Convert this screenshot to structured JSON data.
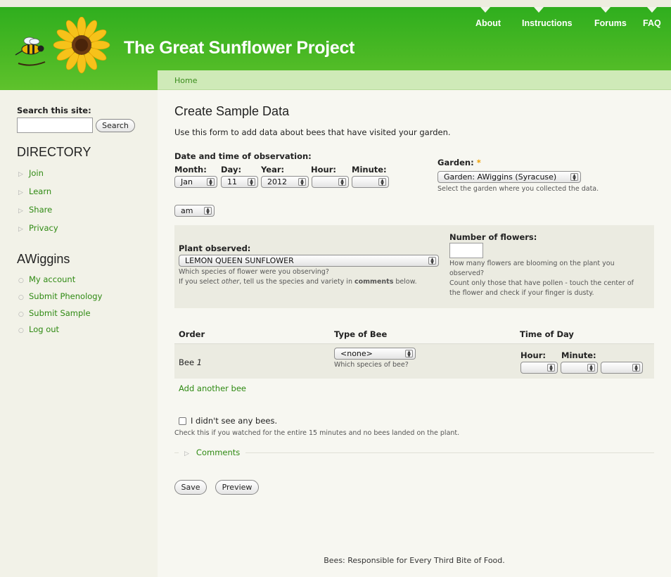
{
  "site": {
    "title": "The Great Sunflower Project"
  },
  "topnav": [
    "About",
    "Instructions",
    "Forums",
    "FAQ"
  ],
  "breadcrumb": "Home",
  "sidebar": {
    "search_label": "Search this site:",
    "search_button": "Search",
    "directory_heading": "DIRECTORY",
    "directory_items": [
      "Join",
      "Learn",
      "Share",
      "Privacy"
    ],
    "user_heading": "AWiggins",
    "user_items": [
      "My account",
      "Submit Phenology",
      "Submit Sample",
      "Log out"
    ]
  },
  "form": {
    "title": "Create Sample Data",
    "intro": "Use this form to add data about bees that have visited your garden.",
    "datetime_label": "Date and time of observation:",
    "month_label": "Month:",
    "month_value": "Jan",
    "day_label": "Day:",
    "day_value": "11",
    "year_label": "Year:",
    "year_value": "2012",
    "hour_label": "Hour:",
    "hour_value": "",
    "minute_label": "Minute:",
    "minute_value": "",
    "ampm_value": "am",
    "garden_label": "Garden:",
    "garden_required": "*",
    "garden_value": "Garden: AWiggins (Syracuse)",
    "garden_desc": "Select the garden where you collected the data.",
    "plant_label": "Plant observed:",
    "plant_value": "LEMON QUEEN SUNFLOWER",
    "plant_desc1": "Which species of flower were you observing?",
    "plant_desc2_a": "If you select ",
    "plant_desc2_other": "other",
    "plant_desc2_b": ", tell us the species and variety in ",
    "plant_desc2_comments": "comments",
    "plant_desc2_c": " below.",
    "flowers_label": "Number of flowers:",
    "flowers_desc1": "How many flowers are blooming on the plant you",
    "flowers_desc2": "observed?",
    "flowers_desc3": "Count only those that have pollen - touch the center of",
    "flowers_desc4": "the flower and check if your finger is dusty.",
    "table_headers": [
      "Order",
      "Type of Bee",
      "Time of Day"
    ],
    "bee_label": "Bee",
    "bee_number": "1",
    "bee_type_value": "<none>",
    "bee_type_desc": "Which species of bee?",
    "bee_hour_label": "Hour:",
    "bee_minute_label": "Minute:",
    "add_bee": "Add another bee",
    "no_bees_label": "I didn't see any bees.",
    "no_bees_desc": "Check this if you watched for the entire 15 minutes and no bees landed on the plant.",
    "comments_legend": "Comments",
    "save_button": "Save",
    "preview_button": "Preview"
  },
  "footer": "Bees: Responsible for Every Third Bite of Food."
}
